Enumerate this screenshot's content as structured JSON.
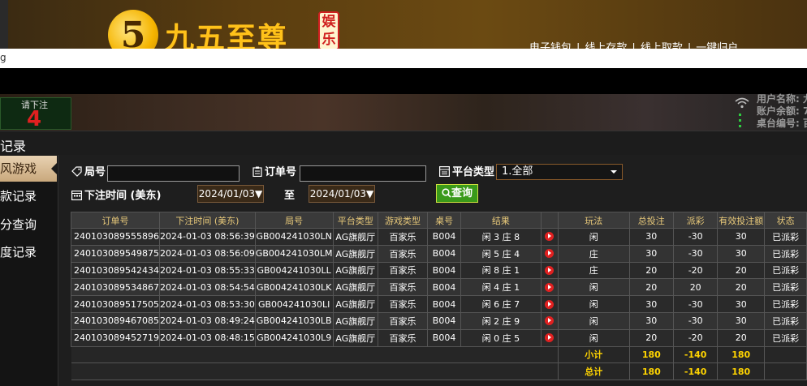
{
  "banner": {
    "logo_digit": "5",
    "logo_text": "九五至尊",
    "logo_tag": "娱乐",
    "links": [
      "电子钱包",
      "线上存款",
      "线上取款",
      "一键归户"
    ]
  },
  "urlbar": {
    "text": "g"
  },
  "scene": {
    "bet_label": "请下注",
    "bet_count": "4",
    "user_info": [
      "用户名称: 九",
      "账户余额: 7",
      "桌台编号: 百"
    ]
  },
  "modal": {
    "title": "记录",
    "sidebar": [
      "风游戏",
      "款记录",
      "分查询",
      "度记录"
    ]
  },
  "filters": {
    "round_label": "局号",
    "round_value": "",
    "order_label": "订单号",
    "order_value": "",
    "platform_label": "平台类型",
    "platform_value": "1.全部",
    "time_label": "下注时间 (美东)",
    "date_from": "2024/01/03▼",
    "to_label": "至",
    "date_to": "2024/01/03▼",
    "query_label": "查询"
  },
  "table": {
    "headers": [
      "订单号",
      "下注时间 (美东)",
      "局号",
      "平台类型",
      "游戏类型",
      "桌号",
      "结果",
      "",
      "玩法",
      "总投注",
      "派彩",
      "有效投注额",
      "状态"
    ],
    "rows": [
      {
        "order": "240103089555896",
        "time": "2024-01-03 08:56:39",
        "round": "GB004241030LN",
        "platform": "AG旗舰厅",
        "game": "百家乐",
        "table": "B004",
        "result": "闲 3 庄 8",
        "play": "闲",
        "bet": "30",
        "payout": "-30",
        "valid": "30",
        "status": "已派彩"
      },
      {
        "order": "240103089549875",
        "time": "2024-01-03 08:56:09",
        "round": "GB004241030LM",
        "platform": "AG旗舰厅",
        "game": "百家乐",
        "table": "B004",
        "result": "闲 5 庄 4",
        "play": "庄",
        "bet": "30",
        "payout": "-30",
        "valid": "30",
        "status": "已派彩"
      },
      {
        "order": "240103089542434",
        "time": "2024-01-03 08:55:33",
        "round": "GB004241030LL",
        "platform": "AG旗舰厅",
        "game": "百家乐",
        "table": "B004",
        "result": "闲 8 庄 1",
        "play": "庄",
        "bet": "20",
        "payout": "-20",
        "valid": "20",
        "status": "已派彩"
      },
      {
        "order": "240103089534867",
        "time": "2024-01-03 08:54:54",
        "round": "GB004241030LK",
        "platform": "AG旗舰厅",
        "game": "百家乐",
        "table": "B004",
        "result": "闲 4 庄 1",
        "play": "闲",
        "bet": "20",
        "payout": "20",
        "valid": "20",
        "status": "已派彩"
      },
      {
        "order": "240103089517505",
        "time": "2024-01-03 08:53:30",
        "round": "GB004241030LI",
        "platform": "AG旗舰厅",
        "game": "百家乐",
        "table": "B004",
        "result": "闲 6 庄 7",
        "play": "闲",
        "bet": "30",
        "payout": "-30",
        "valid": "30",
        "status": "已派彩"
      },
      {
        "order": "240103089467085",
        "time": "2024-01-03 08:49:24",
        "round": "GB004241030LB",
        "platform": "AG旗舰厅",
        "game": "百家乐",
        "table": "B004",
        "result": "闲 2 庄 9",
        "play": "闲",
        "bet": "30",
        "payout": "-30",
        "valid": "30",
        "status": "已派彩"
      },
      {
        "order": "240103089452719",
        "time": "2024-01-03 08:48:15",
        "round": "GB004241030L9",
        "platform": "AG旗舰厅",
        "game": "百家乐",
        "table": "B004",
        "result": "闲 0 庄 5",
        "play": "闲",
        "bet": "20",
        "payout": "-20",
        "valid": "20",
        "status": "已派彩"
      }
    ],
    "subtotal": {
      "label": "小计",
      "bet": "180",
      "payout": "-140",
      "valid": "180"
    },
    "total": {
      "label": "总计",
      "bet": "180",
      "payout": "-140",
      "valid": "180"
    }
  },
  "colors": {
    "positive": "#2ecc40",
    "negative": "#9a2020",
    "summary": "#ffd400",
    "header": "#e8c97a"
  }
}
